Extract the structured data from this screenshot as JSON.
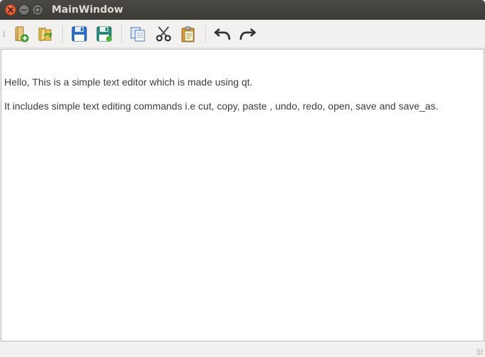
{
  "window": {
    "title": "MainWindow"
  },
  "toolbar": {
    "items": [
      {
        "name": "new-file",
        "icon": "new-file-icon"
      },
      {
        "name": "open-file",
        "icon": "open-folder-icon"
      },
      {
        "name": "save",
        "icon": "save-icon"
      },
      {
        "name": "save-as",
        "icon": "save-as-icon"
      },
      {
        "name": "copy",
        "icon": "copy-icon"
      },
      {
        "name": "cut",
        "icon": "scissors-icon"
      },
      {
        "name": "paste",
        "icon": "paste-icon"
      },
      {
        "name": "undo",
        "icon": "undo-icon"
      },
      {
        "name": "redo",
        "icon": "redo-icon"
      }
    ]
  },
  "editor": {
    "lines": [
      "Hello, This is a simple text editor which is made using qt.",
      "It includes simple text editing commands i.e cut, copy, paste , undo, redo, open, save and save_as."
    ]
  },
  "colors": {
    "titlebar": "#3c3b37",
    "close_button": "#e0532a",
    "save_blue": "#2a6fc9",
    "folder_yellow": "#e8c050"
  }
}
